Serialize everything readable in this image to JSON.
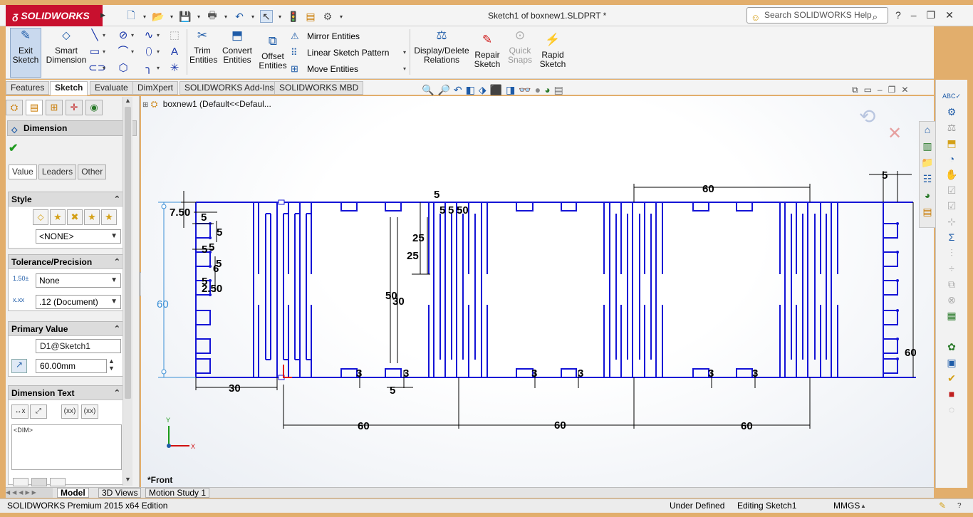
{
  "titlebar": {
    "brand": "SOLIDWORKS",
    "document_title": "Sketch1 of boxnew1.SLDPRT *",
    "help_placeholder": "Search SOLIDWORKS Help",
    "quick_access": [
      "new-icon",
      "open-icon",
      "save-icon",
      "print-icon",
      "undo-icon",
      "select-icon",
      "rebuild-icon",
      "file-properties-icon",
      "options-icon"
    ]
  },
  "ribbon": {
    "exit_sketch": "Exit\nSketch",
    "smart_dimension": "Smart\nDimension",
    "trim_entities": "Trim\nEntities",
    "convert_entities": "Convert\nEntities",
    "offset_entities": "Offset\nEntities",
    "mirror_entities": "Mirror Entities",
    "linear_sketch_pattern": "Linear Sketch Pattern",
    "move_entities": "Move Entities",
    "display_delete_relations": "Display/Delete\nRelations",
    "repair_sketch": "Repair\nSketch",
    "quick_snaps": "Quick\nSnaps",
    "rapid_sketch": "Rapid\nSketch"
  },
  "tabs": [
    "Features",
    "Sketch",
    "Evaluate",
    "DimXpert",
    "SOLIDWORKS Add-Ins",
    "SOLIDWORKS MBD"
  ],
  "left_panel": {
    "title": "Dimension",
    "help": "?",
    "sub_tabs": [
      "Value",
      "Leaders",
      "Other"
    ],
    "style": {
      "header": "Style",
      "value": "<NONE>"
    },
    "tolerance": {
      "header": "Tolerance/Precision",
      "tolerance_type": "None",
      "precision": ".12 (Document)"
    },
    "primary_value": {
      "header": "Primary Value",
      "name": "D1@Sketch1",
      "value": "60.00mm"
    },
    "dimension_text": {
      "header": "Dimension Text",
      "text": "<DIM>"
    }
  },
  "canvas": {
    "tree_node": "boxnew1  (Default<<Defaul...",
    "view_name": "*Front",
    "axis_x": "X",
    "axis_y": "Y",
    "dimensions": [
      "7.50",
      "5",
      "5",
      "5",
      "5",
      "5",
      "6",
      "5",
      "2.50",
      "60",
      "30",
      "5",
      "3",
      "3",
      "3",
      "3",
      "3",
      "3",
      "60",
      "60",
      "60",
      "60",
      "25",
      "25",
      "50",
      "30",
      "5",
      "5",
      "5",
      "5",
      "50",
      "60",
      "5",
      "60"
    ]
  },
  "bottom_tabs": [
    "Model",
    "3D Views",
    "Motion Study 1"
  ],
  "status": {
    "edition": "SOLIDWORKS Premium 2015 x64 Edition",
    "state": "Under Defined",
    "editing": "Editing Sketch1",
    "units": "MMGS"
  },
  "colors": {
    "sketch_line": "#1414d6",
    "dimension_text": "#000000",
    "driving_dim": "#3a8fd6",
    "brand_red": "#c8102e"
  }
}
